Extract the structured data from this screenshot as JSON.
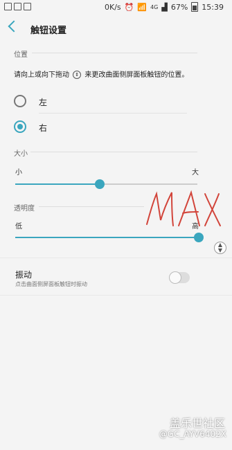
{
  "status": {
    "speed": "0K/s",
    "network_badge": "4G",
    "battery": "67%",
    "time": "15:39"
  },
  "appbar": {
    "title": "触钮设置"
  },
  "position_section": {
    "header": "位置",
    "description_before": "请向上或向下拖动",
    "description_after": "来更改曲面侧屏面板触钮的位置。",
    "options": [
      {
        "label": "左",
        "selected": false
      },
      {
        "label": "右",
        "selected": true
      }
    ]
  },
  "size_section": {
    "header": "大小",
    "min_label": "小",
    "max_label": "大",
    "value": 0.46
  },
  "opacity_section": {
    "header": "透明度",
    "min_label": "低",
    "max_label": "高",
    "value": 1.0
  },
  "vibration": {
    "title": "振动",
    "subtitle": "点击曲面侧屏面板触钮时振动",
    "enabled": false
  },
  "annotation": "MAX",
  "watermark": {
    "line1": "盖乐世社区",
    "line2": "@GC_AYV6402X"
  },
  "colors": {
    "accent": "#3aa6be",
    "handwriting": "#d2453b"
  }
}
